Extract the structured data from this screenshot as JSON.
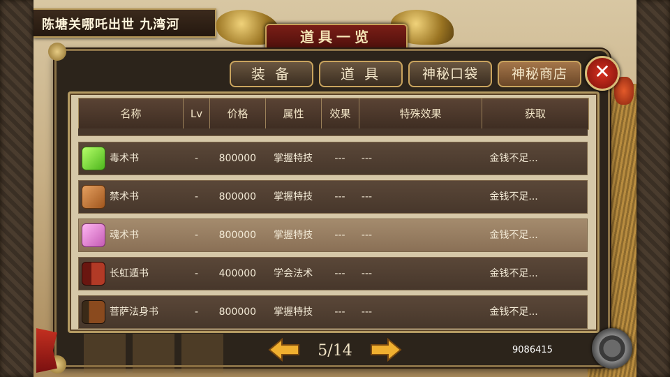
{
  "location": "陈塘关哪吒出世 九湾河",
  "window_title": "道具一览",
  "tabs": [
    {
      "label": "装 备",
      "active": false
    },
    {
      "label": "道 具",
      "active": false
    },
    {
      "label": "神秘口袋",
      "active": false
    },
    {
      "label": "神秘商店",
      "active": true
    }
  ],
  "close_label": "✕",
  "table": {
    "headers": [
      "名称",
      "Lv",
      "价格",
      "属性",
      "效果",
      "特殊效果",
      "获取"
    ],
    "rows": [
      {
        "icon": "green-book-icon",
        "name": "毒术书",
        "lv": "-",
        "price": "800000",
        "attr": "掌握特技",
        "effect": "---",
        "special": "---",
        "get": "金钱不足...",
        "highlighted": false
      },
      {
        "icon": "orange-book-icon",
        "name": "禁术书",
        "lv": "-",
        "price": "800000",
        "attr": "掌握特技",
        "effect": "---",
        "special": "---",
        "get": "金钱不足...",
        "highlighted": false
      },
      {
        "icon": "pink-book-icon",
        "name": "魂术书",
        "lv": "-",
        "price": "800000",
        "attr": "掌握特技",
        "effect": "---",
        "special": "---",
        "get": "金钱不足...",
        "highlighted": true
      },
      {
        "icon": "red-tome-icon",
        "name": "长虹遁书",
        "lv": "-",
        "price": "400000",
        "attr": "学会法术",
        "effect": "---",
        "special": "---",
        "get": "金钱不足...",
        "highlighted": false
      },
      {
        "icon": "brown-tome-icon",
        "name": "菩萨法身书",
        "lv": "-",
        "price": "800000",
        "attr": "掌握特技",
        "effect": "---",
        "special": "---",
        "get": "金钱不足...",
        "highlighted": false
      }
    ]
  },
  "pager": {
    "current": "5",
    "total": "14",
    "text": "5/14"
  },
  "money": "9086415"
}
